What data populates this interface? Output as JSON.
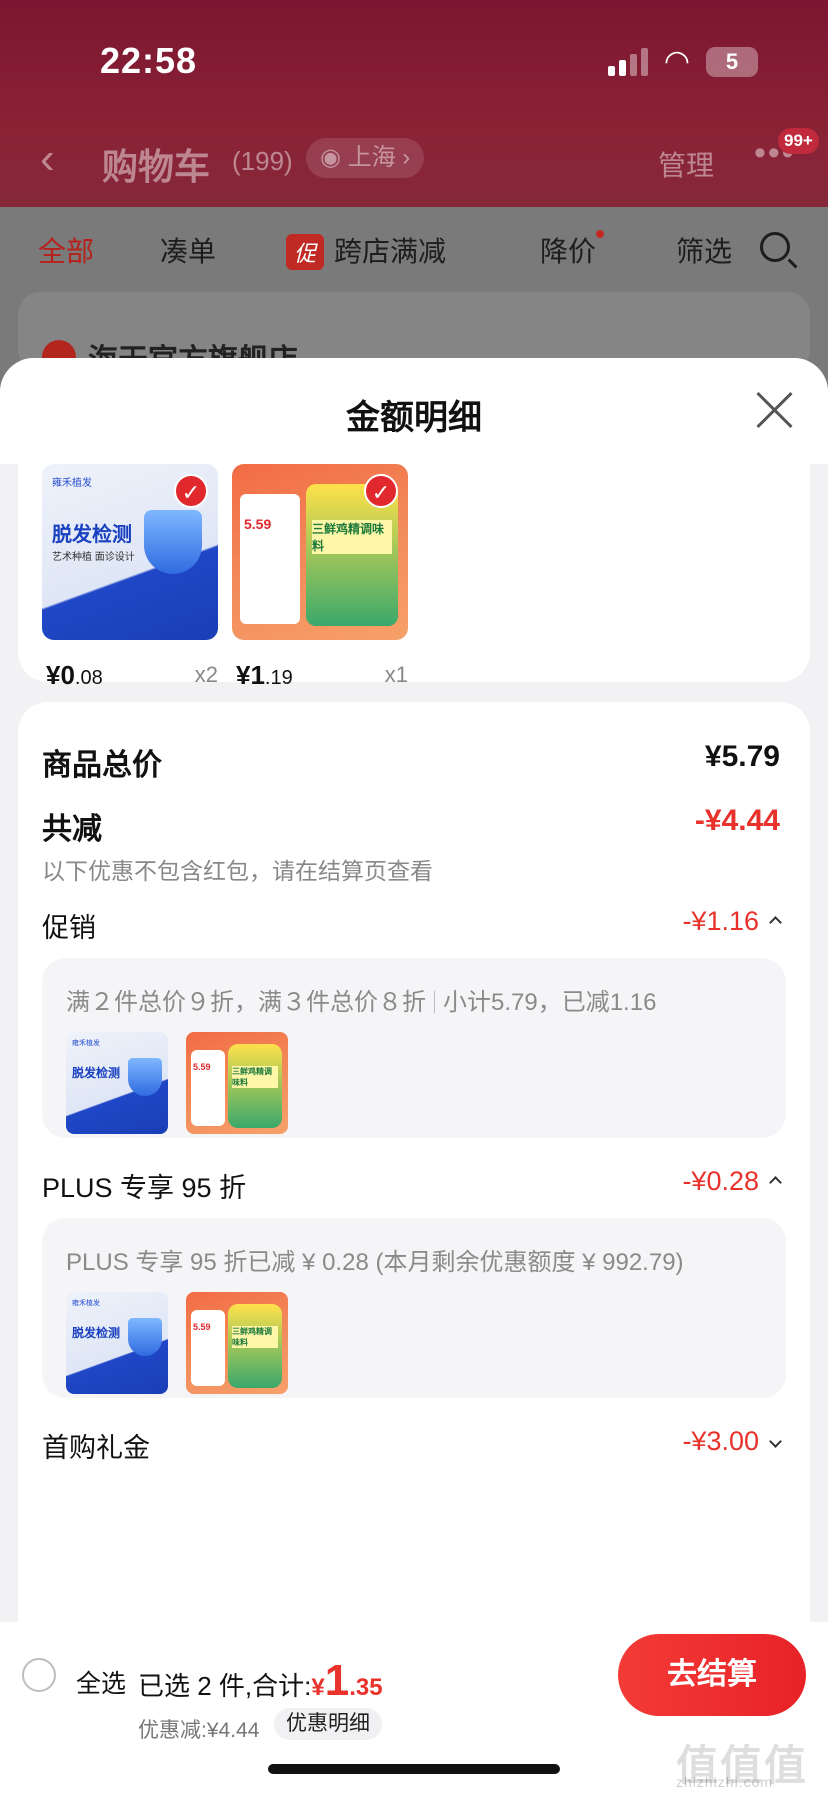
{
  "status_bar": {
    "time": "22:58",
    "battery": "5"
  },
  "nav": {
    "title": "购物车",
    "count": "(199)",
    "location": "上海",
    "manage": "管理",
    "more_badge": "99+"
  },
  "tabs": {
    "all": "全部",
    "add_on": "凑单",
    "promo_badge": "促",
    "cross_store": "跨店满减",
    "price_drop": "降价",
    "filter": "筛选"
  },
  "background_store": "海天官方旗舰店",
  "sheet": {
    "title": "金额明细"
  },
  "products": [
    {
      "price_int": "¥0",
      "price_dec": ".08",
      "qty": "x2",
      "thumb_brand": "雍禾植发",
      "thumb_title": "脱发检测",
      "thumb_sub": "艺术种植 面诊设计"
    },
    {
      "price_int": "¥1",
      "price_dec": ".19",
      "qty": "x1",
      "thumb_price": "5.59",
      "thumb_title": "三鲜鸡精调味料"
    }
  ],
  "summary": {
    "total_label": "商品总价",
    "total_value": "¥5.79",
    "reduce_label": "共减",
    "reduce_value": "-¥4.44",
    "reduce_note": "以下优惠不包含红包，请在结算页查看",
    "promo_label": "促销",
    "promo_value": "-¥1.16",
    "promo_rule": "满２件总价９折，满３件总价８折",
    "promo_subtotal": "小计5.79，已减1.16",
    "plus_label": "PLUS 专享 95 折",
    "plus_value": "-¥0.28",
    "plus_detail": "PLUS 专享 95 折已减 ¥ 0.28 (本月剩余优惠额度 ¥ 992.79)",
    "first_label": "首购礼金",
    "first_value": "-¥3.00"
  },
  "bottom": {
    "select_all": "全选",
    "selected_text": "已选 2 件,合计:",
    "total_yen": "¥",
    "total_int": "1",
    "total_dec": ".35",
    "discount_text": "优惠减:¥4.44",
    "detail_pill": "优惠明细",
    "checkout": "去结算"
  },
  "watermark": {
    "main": "值值值",
    "sub": "zhizhizhi.com"
  },
  "colors": {
    "accent_red": "#e8322b",
    "header_maroon": "#7b1630"
  }
}
